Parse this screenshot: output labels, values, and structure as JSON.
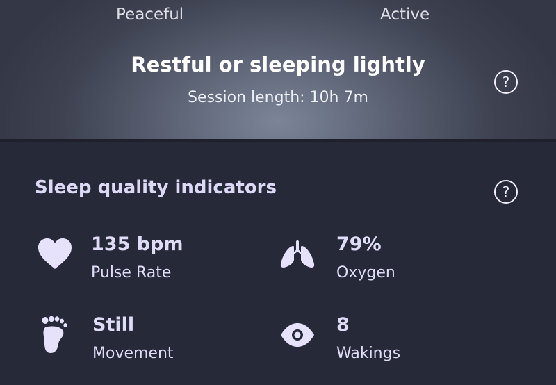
{
  "status_header": {
    "scale_left": "Peaceful",
    "scale_right": "Active",
    "state_title": "Restful or sleeping lightly",
    "session_length": "Session length: 10h 7m",
    "help_symbol": "?"
  },
  "indicators": {
    "title": "Sleep quality indicators",
    "help_symbol": "?",
    "items": [
      {
        "value": "135 bpm",
        "label": "Pulse Rate",
        "icon": "heart-icon"
      },
      {
        "value": "79%",
        "label": "Oxygen",
        "icon": "lungs-icon"
      },
      {
        "value": "Still",
        "label": "Movement",
        "icon": "footprint-icon"
      },
      {
        "value": "8",
        "label": "Wakings",
        "icon": "eye-icon"
      }
    ]
  },
  "colors": {
    "background": "#262a38",
    "accent_text": "#dcd8f6",
    "icon_fill": "#e6e2fb"
  }
}
